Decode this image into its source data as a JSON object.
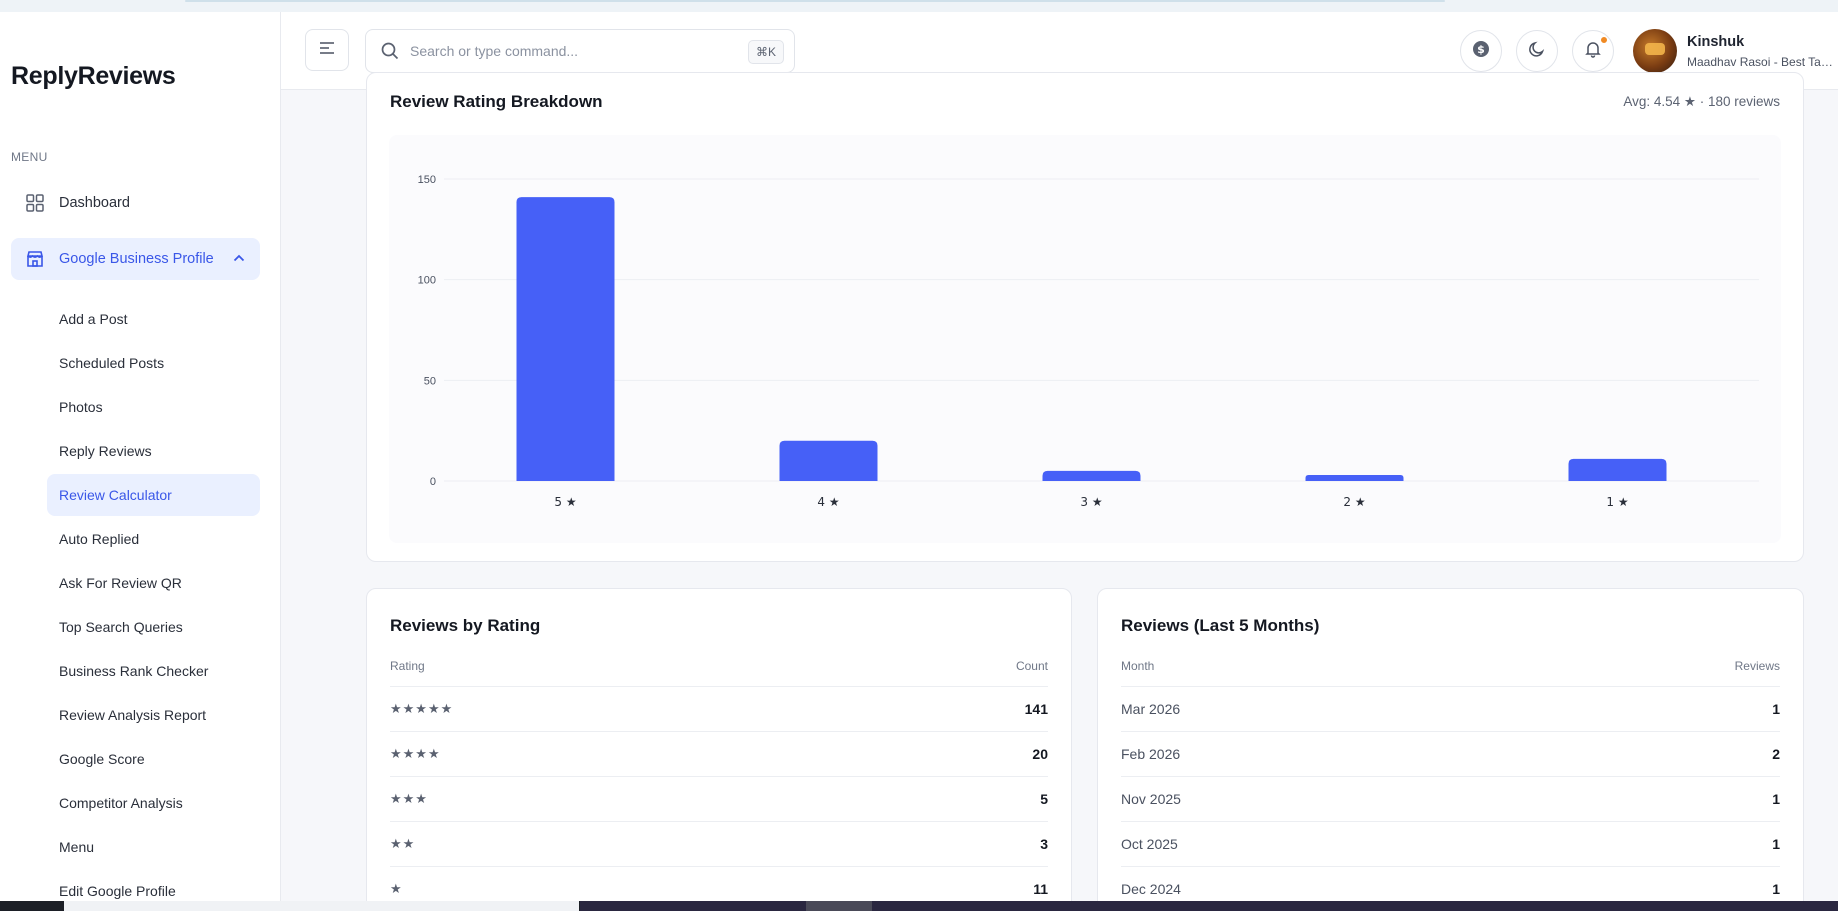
{
  "app": {
    "name": "ReplyReviews"
  },
  "sidebar": {
    "menu_label": "MENU",
    "dashboard": {
      "label": "Dashboard",
      "icon": "grid-icon"
    },
    "gbp": {
      "label": "Google Business Profile",
      "icon": "store-icon",
      "expanded": true
    },
    "sub_items": [
      {
        "label": "Add a Post"
      },
      {
        "label": "Scheduled Posts"
      },
      {
        "label": "Photos"
      },
      {
        "label": "Reply Reviews"
      },
      {
        "label": "Review Calculator",
        "active": true
      },
      {
        "label": "Auto Replied"
      },
      {
        "label": "Ask For Review QR"
      },
      {
        "label": "Top Search Queries"
      },
      {
        "label": "Business Rank Checker"
      },
      {
        "label": "Review Analysis Report"
      },
      {
        "label": "Google Score"
      },
      {
        "label": "Competitor Analysis"
      },
      {
        "label": "Menu"
      },
      {
        "label": "Edit Google Profile"
      }
    ]
  },
  "header": {
    "search_placeholder": "Search or type command...",
    "shortcut": "⌘K",
    "user": {
      "name": "Kinshuk",
      "business": "Maadhav Rasoi - Best Tandoori"
    },
    "notification_dot_color": "#f08a24"
  },
  "breakdown": {
    "title": "Review Rating Breakdown",
    "meta": "Avg: 4.54 ★ · 180 reviews"
  },
  "chart_data": {
    "type": "bar",
    "categories": [
      "5 ★",
      "4 ★",
      "3 ★",
      "2 ★",
      "1 ★"
    ],
    "values": [
      141,
      20,
      5,
      3,
      11
    ],
    "yticks": [
      0,
      50,
      100,
      150
    ],
    "ylim": [
      0,
      150
    ],
    "color": "#4660f7",
    "grid": true,
    "title": "",
    "xlabel": "",
    "ylabel": ""
  },
  "by_rating": {
    "title": "Reviews by Rating",
    "col_left": "Rating",
    "col_right": "Count",
    "rows": [
      {
        "label": "★★★★★",
        "value": "141"
      },
      {
        "label": "★★★★",
        "value": "20"
      },
      {
        "label": "★★★",
        "value": "5"
      },
      {
        "label": "★★",
        "value": "3"
      },
      {
        "label": "★",
        "value": "11"
      }
    ]
  },
  "by_month": {
    "title": "Reviews (Last 5 Months)",
    "col_left": "Month",
    "col_right": "Reviews",
    "rows": [
      {
        "label": "Mar 2026",
        "value": "1"
      },
      {
        "label": "Feb 2026",
        "value": "2"
      },
      {
        "label": "Nov 2025",
        "value": "1"
      },
      {
        "label": "Oct 2025",
        "value": "1"
      },
      {
        "label": "Dec 2024",
        "value": "1"
      }
    ]
  }
}
